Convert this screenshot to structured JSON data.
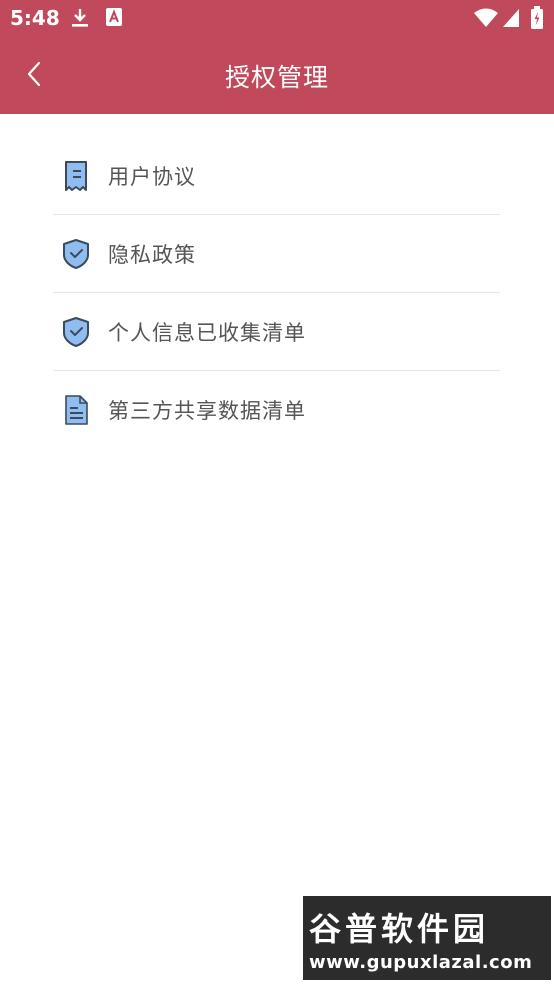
{
  "status_bar": {
    "time": "5:48",
    "icons": [
      "download-icon",
      "a-app-icon",
      "wifi-icon",
      "cell-signal-icon",
      "battery-icon"
    ]
  },
  "header": {
    "title": "授权管理",
    "back_icon": "chevron-left-icon"
  },
  "menu": {
    "items": [
      {
        "label": "用户协议",
        "icon": "document-agreement-icon"
      },
      {
        "label": "隐私政策",
        "icon": "shield-check-icon"
      },
      {
        "label": "个人信息已收集清单",
        "icon": "shield-check-icon"
      },
      {
        "label": "第三方共享数据清单",
        "icon": "document-list-icon"
      }
    ]
  },
  "watermark": {
    "text": "谷普软件园",
    "url": "www.gupuxlazal.com"
  },
  "colors": {
    "brand": "#c04a5c",
    "icon_fill": "#8fbdf0",
    "icon_stroke": "#3d4a5a"
  }
}
